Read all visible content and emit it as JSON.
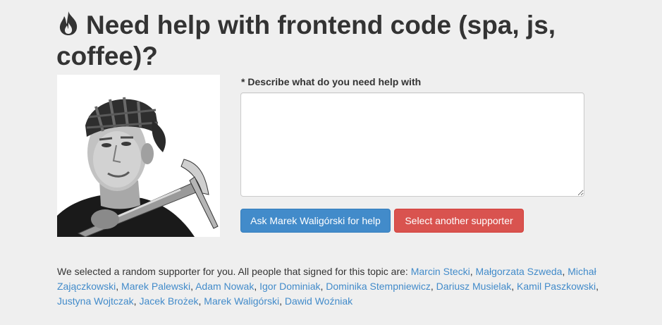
{
  "page": {
    "title": "Need help with frontend code (spa, js, coffee)?",
    "title_icon": "fire-icon"
  },
  "form": {
    "label": "* Describe what do you need help with",
    "textarea_value": "",
    "ask_button": "Ask Marek Waligórski for help",
    "select_button": "Select another supporter"
  },
  "supporter_photo": {
    "icon": "supporter-photo",
    "description_hidden": true
  },
  "supporters": {
    "intro": "We selected a random supporter for you. All people that signed for this topic are: ",
    "separator": ", ",
    "names": [
      "Marcin Stecki",
      "Małgorzata Szweda",
      "Michał Zajączkowski",
      "Marek Palewski",
      "Adam Nowak",
      "Igor Dominiak",
      "Dominika Stempniewicz",
      "Dariusz Musielak",
      "Kamil Paszkowski",
      "Justyna Wojtczak",
      "Jacek Brożek",
      "Marek Waligórski",
      "Dawid Woźniak"
    ]
  },
  "colors": {
    "background": "#efefef",
    "primary": "#428bca",
    "danger": "#d9534f",
    "link": "#428bca",
    "text": "#333333"
  }
}
